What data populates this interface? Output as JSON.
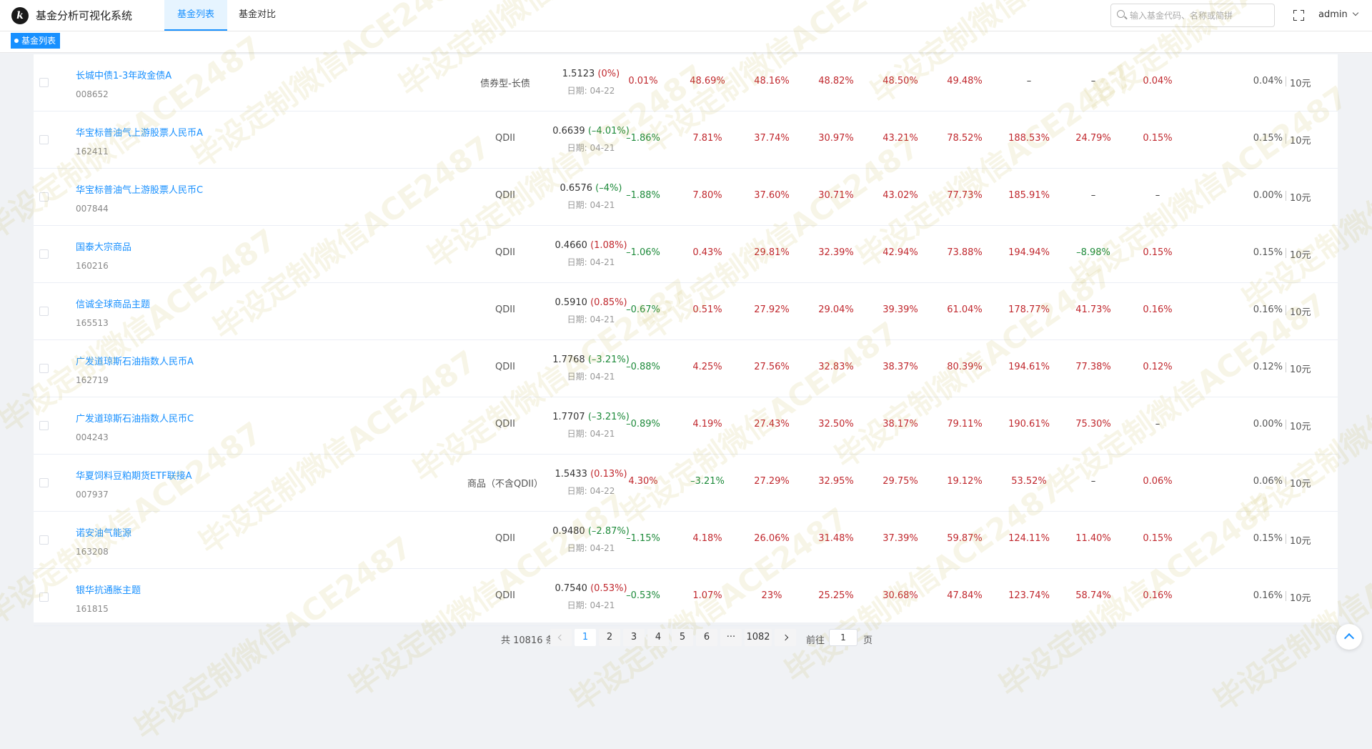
{
  "header": {
    "logo_letter": "k",
    "app_title": "基金分析可视化系统",
    "tabs": [
      {
        "label": "基金列表",
        "active": true
      },
      {
        "label": "基金对比",
        "active": false
      }
    ],
    "search_placeholder": "输入基金代码、名称或简拼",
    "user": "admin"
  },
  "tagsbar": {
    "active_tag": "基金列表"
  },
  "colors": {
    "accent": "#1890ff",
    "rise": "#c0272d",
    "fall": "#1d8a3a"
  },
  "watermark": "毕设定制微信ACE2487",
  "funds": [
    {
      "name": "长城中债1-3年政金债A",
      "code": "008652",
      "type": "债券型-长债",
      "nav": "1.5123",
      "nav_change": "(0%)",
      "nav_change_sign": "up",
      "date": "日期: 04-22",
      "returns": [
        {
          "v": "0.01%",
          "s": "up"
        },
        {
          "v": "48.69%",
          "s": "up"
        },
        {
          "v": "48.16%",
          "s": "up"
        },
        {
          "v": "48.82%",
          "s": "up"
        },
        {
          "v": "48.50%",
          "s": "up"
        },
        {
          "v": "49.48%",
          "s": "up"
        },
        {
          "v": "–",
          "s": "neu"
        },
        {
          "v": "–",
          "s": "neu"
        },
        {
          "v": "0.04%",
          "s": "up"
        }
      ],
      "fee": "0.04%",
      "min_buy": "10元"
    },
    {
      "name": "华宝标普油气上游股票人民币A",
      "code": "162411",
      "type": "QDII",
      "nav": "0.6639",
      "nav_change": "(–4.01%)",
      "nav_change_sign": "down",
      "date": "日期: 04-21",
      "returns": [
        {
          "v": "–1.86%",
          "s": "down"
        },
        {
          "v": "7.81%",
          "s": "up"
        },
        {
          "v": "37.74%",
          "s": "up"
        },
        {
          "v": "30.97%",
          "s": "up"
        },
        {
          "v": "43.21%",
          "s": "up"
        },
        {
          "v": "78.52%",
          "s": "up"
        },
        {
          "v": "188.53%",
          "s": "up"
        },
        {
          "v": "24.79%",
          "s": "up"
        },
        {
          "v": "0.15%",
          "s": "up"
        }
      ],
      "fee": "0.15%",
      "min_buy": "10元"
    },
    {
      "name": "华宝标普油气上游股票人民币C",
      "code": "007844",
      "type": "QDII",
      "nav": "0.6576",
      "nav_change": "(–4%)",
      "nav_change_sign": "down",
      "date": "日期: 04-21",
      "returns": [
        {
          "v": "–1.88%",
          "s": "down"
        },
        {
          "v": "7.80%",
          "s": "up"
        },
        {
          "v": "37.60%",
          "s": "up"
        },
        {
          "v": "30.71%",
          "s": "up"
        },
        {
          "v": "43.02%",
          "s": "up"
        },
        {
          "v": "77.73%",
          "s": "up"
        },
        {
          "v": "185.91%",
          "s": "up"
        },
        {
          "v": "–",
          "s": "neu"
        },
        {
          "v": "–",
          "s": "neu"
        }
      ],
      "fee": "0.00%",
      "min_buy": "10元"
    },
    {
      "name": "国泰大宗商品",
      "code": "160216",
      "type": "QDII",
      "nav": "0.4660",
      "nav_change": "(1.08%)",
      "nav_change_sign": "up",
      "date": "日期: 04-21",
      "returns": [
        {
          "v": "–1.06%",
          "s": "down"
        },
        {
          "v": "0.43%",
          "s": "up"
        },
        {
          "v": "29.81%",
          "s": "up"
        },
        {
          "v": "32.39%",
          "s": "up"
        },
        {
          "v": "42.94%",
          "s": "up"
        },
        {
          "v": "73.88%",
          "s": "up"
        },
        {
          "v": "194.94%",
          "s": "up"
        },
        {
          "v": "–8.98%",
          "s": "down"
        },
        {
          "v": "0.15%",
          "s": "up"
        }
      ],
      "fee": "0.15%",
      "min_buy": "10元"
    },
    {
      "name": "信诚全球商品主题",
      "code": "165513",
      "type": "QDII",
      "nav": "0.5910",
      "nav_change": "(0.85%)",
      "nav_change_sign": "up",
      "date": "日期: 04-21",
      "returns": [
        {
          "v": "–0.67%",
          "s": "down"
        },
        {
          "v": "0.51%",
          "s": "up"
        },
        {
          "v": "27.92%",
          "s": "up"
        },
        {
          "v": "29.04%",
          "s": "up"
        },
        {
          "v": "39.39%",
          "s": "up"
        },
        {
          "v": "61.04%",
          "s": "up"
        },
        {
          "v": "178.77%",
          "s": "up"
        },
        {
          "v": "41.73%",
          "s": "up"
        },
        {
          "v": "0.16%",
          "s": "up"
        }
      ],
      "fee": "0.16%",
      "min_buy": "10元"
    },
    {
      "name": "广发道琼斯石油指数人民币A",
      "code": "162719",
      "type": "QDII",
      "nav": "1.7768",
      "nav_change": "(–3.21%)",
      "nav_change_sign": "down",
      "date": "日期: 04-21",
      "returns": [
        {
          "v": "–0.88%",
          "s": "down"
        },
        {
          "v": "4.25%",
          "s": "up"
        },
        {
          "v": "27.56%",
          "s": "up"
        },
        {
          "v": "32.83%",
          "s": "up"
        },
        {
          "v": "38.37%",
          "s": "up"
        },
        {
          "v": "80.39%",
          "s": "up"
        },
        {
          "v": "194.61%",
          "s": "up"
        },
        {
          "v": "77.38%",
          "s": "up"
        },
        {
          "v": "0.12%",
          "s": "up"
        }
      ],
      "fee": "0.12%",
      "min_buy": "10元"
    },
    {
      "name": "广发道琼斯石油指数人民币C",
      "code": "004243",
      "type": "QDII",
      "nav": "1.7707",
      "nav_change": "(–3.21%)",
      "nav_change_sign": "down",
      "date": "日期: 04-21",
      "returns": [
        {
          "v": "–0.89%",
          "s": "down"
        },
        {
          "v": "4.19%",
          "s": "up"
        },
        {
          "v": "27.43%",
          "s": "up"
        },
        {
          "v": "32.50%",
          "s": "up"
        },
        {
          "v": "38.17%",
          "s": "up"
        },
        {
          "v": "79.11%",
          "s": "up"
        },
        {
          "v": "190.61%",
          "s": "up"
        },
        {
          "v": "75.30%",
          "s": "up"
        },
        {
          "v": "–",
          "s": "neu"
        }
      ],
      "fee": "0.00%",
      "min_buy": "10元"
    },
    {
      "name": "华夏饲料豆粕期货ETF联接A",
      "code": "007937",
      "type": "商品（不含QDII）",
      "nav": "1.5433",
      "nav_change": "(0.13%)",
      "nav_change_sign": "up",
      "date": "日期: 04-22",
      "returns": [
        {
          "v": "4.30%",
          "s": "up"
        },
        {
          "v": "–3.21%",
          "s": "down"
        },
        {
          "v": "27.29%",
          "s": "up"
        },
        {
          "v": "32.95%",
          "s": "up"
        },
        {
          "v": "29.75%",
          "s": "up"
        },
        {
          "v": "19.12%",
          "s": "up"
        },
        {
          "v": "53.52%",
          "s": "up"
        },
        {
          "v": "–",
          "s": "neu"
        },
        {
          "v": "0.06%",
          "s": "up"
        }
      ],
      "fee": "0.06%",
      "min_buy": "10元"
    },
    {
      "name": "诺安油气能源",
      "code": "163208",
      "type": "QDII",
      "nav": "0.9480",
      "nav_change": "(–2.87%)",
      "nav_change_sign": "down",
      "date": "日期: 04-21",
      "returns": [
        {
          "v": "–1.15%",
          "s": "down"
        },
        {
          "v": "4.18%",
          "s": "up"
        },
        {
          "v": "26.06%",
          "s": "up"
        },
        {
          "v": "31.48%",
          "s": "up"
        },
        {
          "v": "37.39%",
          "s": "up"
        },
        {
          "v": "59.87%",
          "s": "up"
        },
        {
          "v": "124.11%",
          "s": "up"
        },
        {
          "v": "11.40%",
          "s": "up"
        },
        {
          "v": "0.15%",
          "s": "up"
        }
      ],
      "fee": "0.15%",
      "min_buy": "10元"
    },
    {
      "name": "银华抗通胀主题",
      "code": "161815",
      "type": "QDII",
      "nav": "0.7540",
      "nav_change": "(0.53%)",
      "nav_change_sign": "up",
      "date": "日期: 04-21",
      "returns": [
        {
          "v": "–0.53%",
          "s": "down"
        },
        {
          "v": "1.07%",
          "s": "up"
        },
        {
          "v": "23%",
          "s": "up"
        },
        {
          "v": "25.25%",
          "s": "up"
        },
        {
          "v": "30.68%",
          "s": "up"
        },
        {
          "v": "47.84%",
          "s": "up"
        },
        {
          "v": "123.74%",
          "s": "up"
        },
        {
          "v": "58.74%",
          "s": "up"
        },
        {
          "v": "0.16%",
          "s": "up"
        }
      ],
      "fee": "0.16%",
      "min_buy": "10元"
    }
  ],
  "pagination": {
    "total_text": "共 10816 条",
    "pages": [
      "1",
      "2",
      "3",
      "4",
      "5",
      "6"
    ],
    "current": "1",
    "ellipsis": "···",
    "last_page": "1082",
    "goto_label": "前往",
    "goto_value": "1",
    "page_suffix": "页"
  }
}
